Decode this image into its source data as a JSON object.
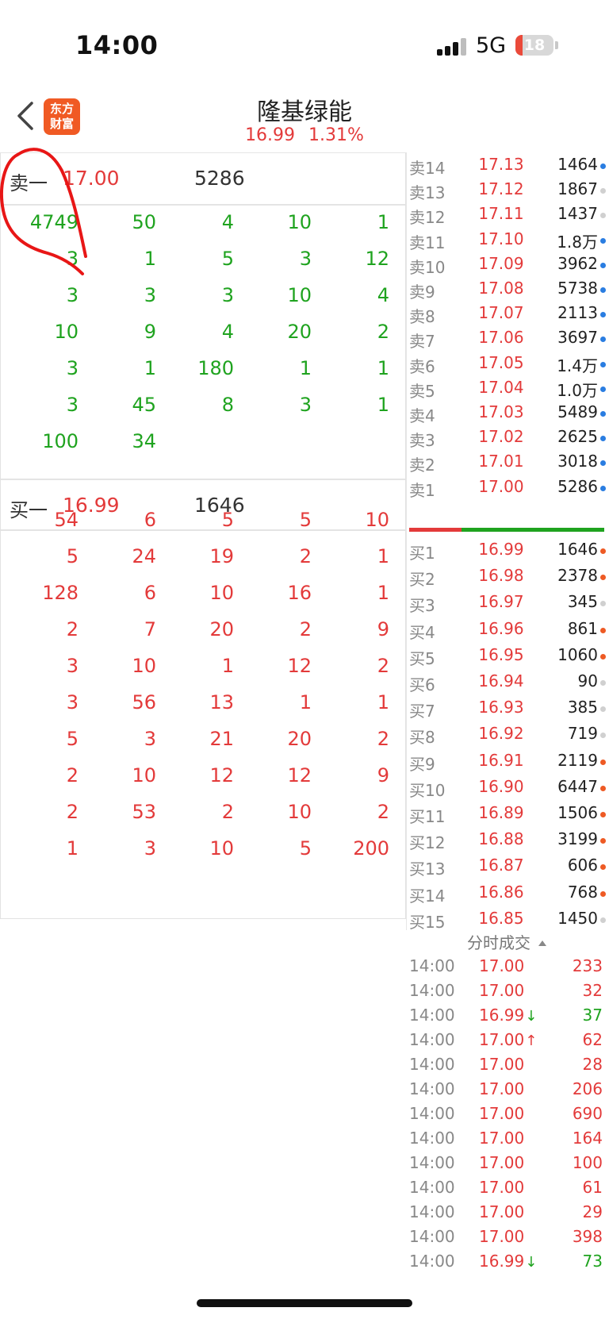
{
  "status_bar": {
    "time": "14:00",
    "network": "5G",
    "battery": "18"
  },
  "header": {
    "logo_line1": "东方",
    "logo_line2": "财富",
    "stock_name": "隆基绿能",
    "price": "16.99",
    "change_pct": "1.31%"
  },
  "sell_first": {
    "label": "卖一",
    "price": "17.00",
    "volume": "5286"
  },
  "sell_queue": [
    [
      "4749",
      "50",
      "4",
      "10",
      "1"
    ],
    [
      "3",
      "1",
      "5",
      "3",
      "12"
    ],
    [
      "3",
      "3",
      "3",
      "10",
      "4"
    ],
    [
      "10",
      "9",
      "4",
      "20",
      "2"
    ],
    [
      "3",
      "1",
      "180",
      "1",
      "1"
    ],
    [
      "3",
      "45",
      "8",
      "3",
      "1"
    ],
    [
      "100",
      "34",
      "",
      "",
      ""
    ]
  ],
  "buy_first": {
    "label": "买一",
    "price": "16.99",
    "volume": "1646"
  },
  "buy_queue": [
    [
      "54",
      "6",
      "5",
      "5",
      "10"
    ],
    [
      "5",
      "24",
      "19",
      "2",
      "1"
    ],
    [
      "128",
      "6",
      "10",
      "16",
      "1"
    ],
    [
      "2",
      "7",
      "20",
      "2",
      "9"
    ],
    [
      "3",
      "10",
      "1",
      "12",
      "2"
    ],
    [
      "3",
      "56",
      "13",
      "1",
      "1"
    ],
    [
      "5",
      "3",
      "21",
      "20",
      "2"
    ],
    [
      "2",
      "10",
      "12",
      "12",
      "9"
    ],
    [
      "2",
      "53",
      "2",
      "10",
      "2"
    ],
    [
      "1",
      "3",
      "10",
      "5",
      "200"
    ]
  ],
  "ask_ladder": [
    {
      "label": "卖14",
      "price": "17.13",
      "volume": "1464",
      "dot": "blue"
    },
    {
      "label": "卖13",
      "price": "17.12",
      "volume": "1867",
      "dot": "gray"
    },
    {
      "label": "卖12",
      "price": "17.11",
      "volume": "1437",
      "dot": "gray"
    },
    {
      "label": "卖11",
      "price": "17.10",
      "volume": "1.8万",
      "dot": "blue"
    },
    {
      "label": "卖10",
      "price": "17.09",
      "volume": "3962",
      "dot": "blue"
    },
    {
      "label": "卖9",
      "price": "17.08",
      "volume": "5738",
      "dot": "blue"
    },
    {
      "label": "卖8",
      "price": "17.07",
      "volume": "2113",
      "dot": "blue"
    },
    {
      "label": "卖7",
      "price": "17.06",
      "volume": "3697",
      "dot": "blue"
    },
    {
      "label": "卖6",
      "price": "17.05",
      "volume": "1.4万",
      "dot": "blue"
    },
    {
      "label": "卖5",
      "price": "17.04",
      "volume": "1.0万",
      "dot": "blue"
    },
    {
      "label": "卖4",
      "price": "17.03",
      "volume": "5489",
      "dot": "blue"
    },
    {
      "label": "卖3",
      "price": "17.02",
      "volume": "2625",
      "dot": "blue"
    },
    {
      "label": "卖2",
      "price": "17.01",
      "volume": "3018",
      "dot": "blue"
    },
    {
      "label": "卖1",
      "price": "17.00",
      "volume": "5286",
      "dot": "blue"
    }
  ],
  "bid_ladder": [
    {
      "label": "买1",
      "price": "16.99",
      "volume": "1646",
      "dot": "orange"
    },
    {
      "label": "买2",
      "price": "16.98",
      "volume": "2378",
      "dot": "orange"
    },
    {
      "label": "买3",
      "price": "16.97",
      "volume": "345",
      "dot": "gray"
    },
    {
      "label": "买4",
      "price": "16.96",
      "volume": "861",
      "dot": "orange"
    },
    {
      "label": "买5",
      "price": "16.95",
      "volume": "1060",
      "dot": "orange"
    },
    {
      "label": "买6",
      "price": "16.94",
      "volume": "90",
      "dot": "gray"
    },
    {
      "label": "买7",
      "price": "16.93",
      "volume": "385",
      "dot": "gray"
    },
    {
      "label": "买8",
      "price": "16.92",
      "volume": "719",
      "dot": "gray"
    },
    {
      "label": "买9",
      "price": "16.91",
      "volume": "2119",
      "dot": "orange"
    },
    {
      "label": "买10",
      "price": "16.90",
      "volume": "6447",
      "dot": "orange"
    },
    {
      "label": "买11",
      "price": "16.89",
      "volume": "1506",
      "dot": "orange"
    },
    {
      "label": "买12",
      "price": "16.88",
      "volume": "3199",
      "dot": "orange"
    },
    {
      "label": "买13",
      "price": "16.87",
      "volume": "606",
      "dot": "orange"
    },
    {
      "label": "买14",
      "price": "16.86",
      "volume": "768",
      "dot": "orange"
    },
    {
      "label": "买15",
      "price": "16.85",
      "volume": "1450",
      "dot": "gray"
    }
  ],
  "trades_title": "分时成交",
  "trades": [
    {
      "time": "14:00",
      "price": "17.00",
      "arrow": "",
      "volume": "233",
      "side": "red"
    },
    {
      "time": "14:00",
      "price": "17.00",
      "arrow": "",
      "volume": "32",
      "side": "red"
    },
    {
      "time": "14:00",
      "price": "16.99",
      "arrow": "↓",
      "volume": "37",
      "side": "green"
    },
    {
      "time": "14:00",
      "price": "17.00",
      "arrow": "↑",
      "volume": "62",
      "side": "red"
    },
    {
      "time": "14:00",
      "price": "17.00",
      "arrow": "",
      "volume": "28",
      "side": "red"
    },
    {
      "time": "14:00",
      "price": "17.00",
      "arrow": "",
      "volume": "206",
      "side": "red"
    },
    {
      "time": "14:00",
      "price": "17.00",
      "arrow": "",
      "volume": "690",
      "side": "red"
    },
    {
      "time": "14:00",
      "price": "17.00",
      "arrow": "",
      "volume": "164",
      "side": "red"
    },
    {
      "time": "14:00",
      "price": "17.00",
      "arrow": "",
      "volume": "100",
      "side": "red"
    },
    {
      "time": "14:00",
      "price": "17.00",
      "arrow": "",
      "volume": "61",
      "side": "red"
    },
    {
      "time": "14:00",
      "price": "17.00",
      "arrow": "",
      "volume": "29",
      "side": "red"
    },
    {
      "time": "14:00",
      "price": "17.00",
      "arrow": "",
      "volume": "398",
      "side": "red"
    },
    {
      "time": "14:00",
      "price": "16.99",
      "arrow": "↓",
      "volume": "73",
      "side": "green"
    }
  ],
  "colors": {
    "up_red": "#e33a3a",
    "down_green": "#1fa31f",
    "dot_blue": "#2a7de1",
    "dot_orange": "#ee5a24",
    "dot_gray": "#d0d0d0",
    "logo": "#f05a24",
    "annotation": "#e81616"
  },
  "icons": {
    "back": "chevron-left-icon",
    "signal": "cell-signal-icon",
    "battery": "battery-icon",
    "caret": "caret-up-icon"
  }
}
